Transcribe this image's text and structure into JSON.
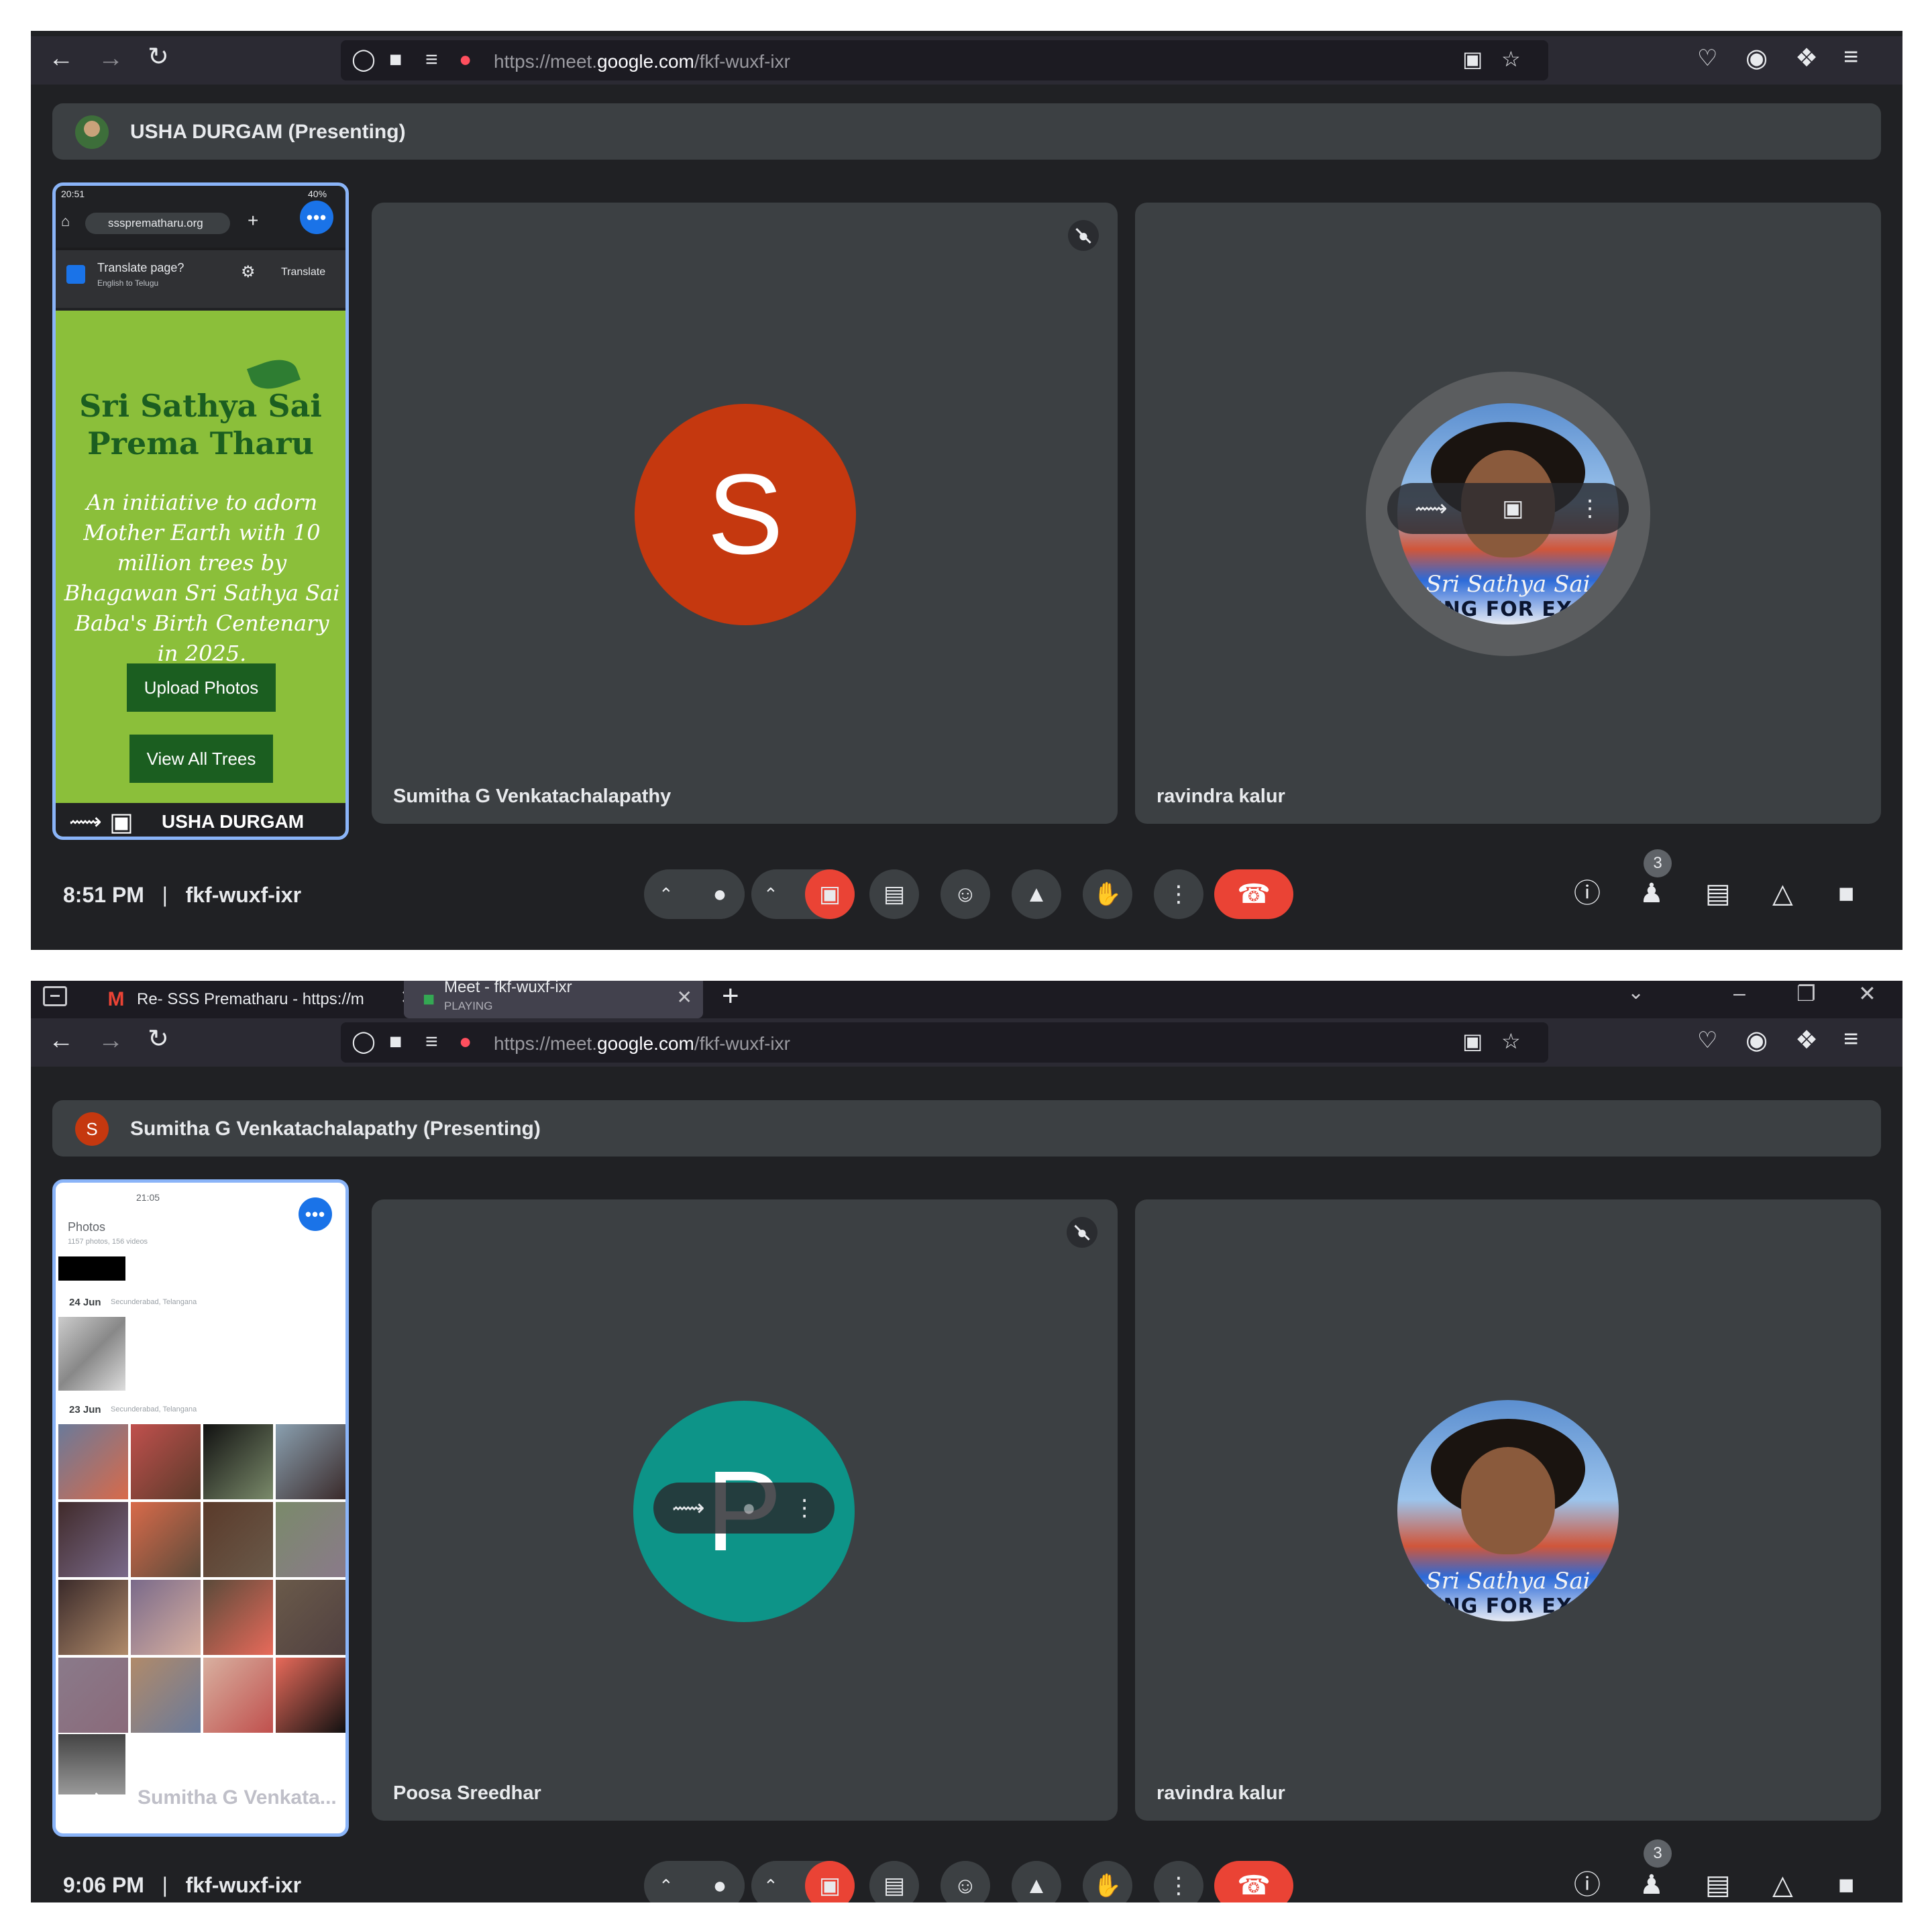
{
  "colors": {
    "meet_bg": "#202124",
    "tile_bg": "#3c4043",
    "accent_blue": "#8ab4f8",
    "end_call_red": "#ea4335",
    "avatar_s": "#c5380f",
    "avatar_p": "#0d9488",
    "site_green": "#8bbf3a",
    "site_button": "#1b5e20"
  },
  "screen1": {
    "browser": {
      "url_prefix": "https://meet.",
      "url_domain": "google.com",
      "url_path": "/fkf-wuxf-ixr"
    },
    "presenter_bar": {
      "label": "USHA DURGAM (Presenting)"
    },
    "share_tile": {
      "phone_status": "20:51",
      "phone_status_right": "40%",
      "phone_url": "sssprematharu.org",
      "translate_title": "Translate page?",
      "translate_sub": "English to Telugu",
      "translate_button": "Translate",
      "site_title_1": "Sri Sathya Sai",
      "site_title_2": "Prema Tharu",
      "site_tagline": "An initiative to adorn Mother Earth with 10 million trees by Bhagawan Sri Sathya Sai Baba's Birth Centenary in 2025.",
      "upload_button": "Upload Photos",
      "view_button": "View All Trees",
      "presenter_name": "USHA DURGAM",
      "dots": "•••"
    },
    "tiles": [
      {
        "name": "Sumitha G Venkatachalapathy",
        "avatar_letter": "S"
      },
      {
        "name": "ravindra kalur",
        "photo_sig": "Sri Sathya Sai",
        "photo_band": "MING FOR EXCE"
      }
    ],
    "bottom": {
      "time": "8:51 PM",
      "separator": "|",
      "code": "fkf-wuxf-ixr",
      "people_count": "3"
    }
  },
  "screen2": {
    "tabs": [
      {
        "label": "Re- SSS Prematharu - https://m",
        "icon": "gmail-icon"
      },
      {
        "label": "Meet - fkf-wuxf-ixr",
        "sub": "PLAYING",
        "icon": "meet-icon"
      }
    ],
    "browser": {
      "url_prefix": "https://meet.",
      "url_domain": "google.com",
      "url_path": "/fkf-wuxf-ixr"
    },
    "presenter_bar": {
      "avatar_letter": "S",
      "label": "Sumitha G Venkatachalapathy (Presenting)"
    },
    "share_tile": {
      "phone_status": "21:05",
      "photos_title": "Photos",
      "photos_count": "1157 photos, 156 videos",
      "date_1": "24 Jun",
      "date_1_sub": "Secunderabad, Telangana",
      "date_2": "23 Jun",
      "date_2_sub": "Secunderabad, Telangana",
      "presenter_name": "Sumitha G Venkata...",
      "dots": "•••"
    },
    "tiles": [
      {
        "name": "Poosa Sreedhar",
        "avatar_letter": "P"
      },
      {
        "name": "ravindra kalur",
        "photo_sig": "Sri Sathya Sai",
        "photo_band": "MING FOR EXCE"
      }
    ],
    "bottom": {
      "time": "9:06 PM",
      "separator": "|",
      "code": "fkf-wuxf-ixr",
      "people_count": "3"
    }
  }
}
